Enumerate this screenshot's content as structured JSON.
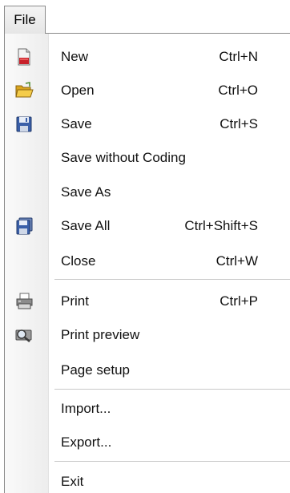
{
  "menubar": {
    "file_label": "File"
  },
  "menu": {
    "items": [
      {
        "label": "New",
        "shortcut": "Ctrl+N",
        "icon": "new-document-icon"
      },
      {
        "label": "Open",
        "shortcut": "Ctrl+O",
        "icon": "open-folder-icon"
      },
      {
        "label": "Save",
        "shortcut": "Ctrl+S",
        "icon": "save-disk-icon"
      },
      {
        "label": "Save without Coding",
        "shortcut": "",
        "icon": ""
      },
      {
        "label": "Save As",
        "shortcut": "",
        "icon": ""
      },
      {
        "label": "Save All",
        "shortcut": "Ctrl+Shift+S",
        "icon": "save-all-icon"
      },
      {
        "label": "Close",
        "shortcut": "Ctrl+W",
        "icon": ""
      },
      {
        "label": "Print",
        "shortcut": "Ctrl+P",
        "icon": "printer-icon"
      },
      {
        "label": "Print preview",
        "shortcut": "",
        "icon": "print-preview-icon"
      },
      {
        "label": "Page setup",
        "shortcut": "",
        "icon": ""
      },
      {
        "label": "Import...",
        "shortcut": "",
        "icon": ""
      },
      {
        "label": "Export...",
        "shortcut": "",
        "icon": ""
      },
      {
        "label": "Exit",
        "shortcut": "",
        "icon": ""
      }
    ]
  },
  "colors": {
    "gutter": "#ededed",
    "separator": "#c9c9c9",
    "border": "#8a8a8a"
  }
}
